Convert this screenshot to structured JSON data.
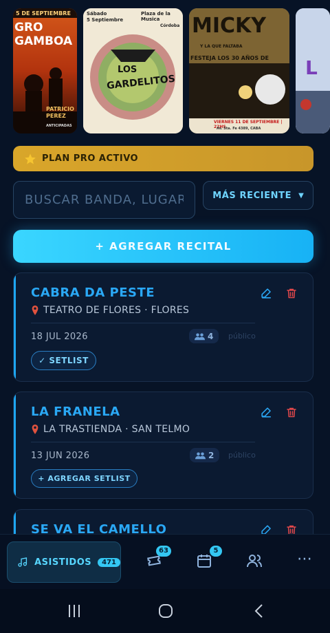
{
  "posters": [
    {
      "top": "5 DE SEPTIEMBRE",
      "title": "GRO GAMBOA",
      "sub1": "PATRICIO",
      "sub2": "PEREZ",
      "extra": "ANTICIPADAS"
    },
    {
      "line1": "Sábado",
      "line2": "5 Septiembre",
      "line3": "Plaza de la Musica",
      "line4": "Córdoba",
      "title1": "LOS",
      "title2": "GARDELITOS"
    },
    {
      "title": "MICKY",
      "sub": "Y LA QUE FALTABA",
      "fest": "FESTEJA LOS 30 AÑOS DE",
      "date": "VIERNES 11 DE SEPTIEMBRE | 22HS",
      "place": "Av. Sta. Fe 4389, CABA"
    },
    {
      "title": "L"
    }
  ],
  "plan": {
    "label": "PLAN PRO ACTIVO",
    "icon": "star-icon",
    "color": "#d9a62a"
  },
  "search": {
    "placeholder": "BUSCAR BANDA, LUGAR"
  },
  "sort": {
    "label": "MÁS RECIENTE",
    "icon": "caret-down-icon"
  },
  "add_button": {
    "label": "+ AGREGAR RECITAL"
  },
  "recitals": [
    {
      "name": "CABRA DA PESTE",
      "venue": "TEATRO DE FLORES · FLORES",
      "date": "18 JUL 2026",
      "attendees": "4",
      "visibility": "público",
      "chip": "✓ SETLIST"
    },
    {
      "name": "LA FRANELA",
      "venue": "LA TRASTIENDA · SAN TELMO",
      "date": "13 JUN 2026",
      "attendees": "2",
      "visibility": "público",
      "chip": "+ AGREGAR SETLIST"
    },
    {
      "name": "SE VA EL CAMELLO"
    }
  ],
  "bottom_nav": {
    "active": {
      "label": "ASISTIDOS",
      "count": "471",
      "icon": "music-note-icon"
    },
    "tickets_badge": "63",
    "calendar_badge": "5",
    "more": "⋯"
  },
  "colors": {
    "accent": "#2aa8f5",
    "background": "#071326",
    "gold": "#d9a62a",
    "danger": "#e2484b"
  }
}
